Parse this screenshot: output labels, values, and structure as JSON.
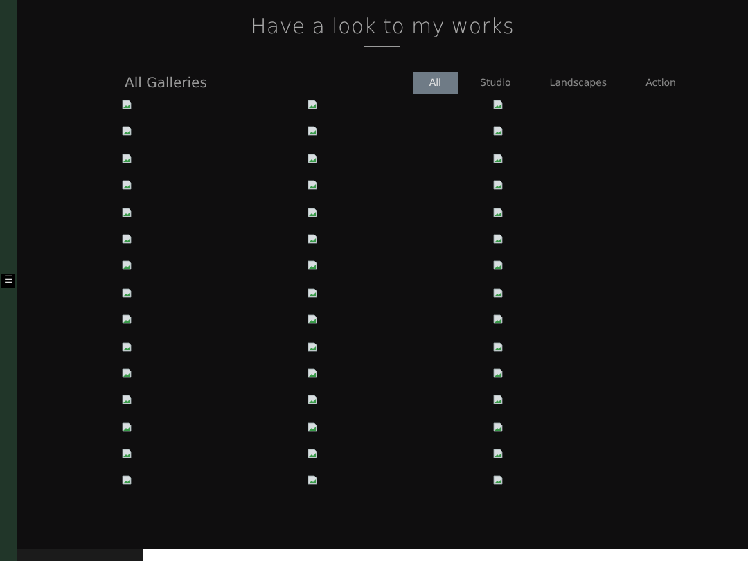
{
  "sidebar": {
    "menu_button": "☰"
  },
  "heading": {
    "title": "Have a look to my works"
  },
  "gallery": {
    "title": "All Galleries",
    "tabs": [
      {
        "label": "All",
        "selected": true
      },
      {
        "label": "Studio",
        "selected": false
      },
      {
        "label": "Landscapes",
        "selected": false
      },
      {
        "label": "Action",
        "selected": false
      }
    ],
    "images": [
      {
        "kind": "broken"
      },
      {
        "kind": "broken"
      },
      {
        "kind": "broken"
      },
      {
        "kind": "broken"
      },
      {
        "kind": "broken"
      },
      {
        "kind": "broken"
      },
      {
        "kind": "broken"
      },
      {
        "kind": "broken"
      },
      {
        "kind": "broken"
      },
      {
        "kind": "broken"
      },
      {
        "kind": "broken"
      },
      {
        "kind": "broken"
      },
      {
        "kind": "broken"
      },
      {
        "kind": "broken"
      },
      {
        "kind": "broken"
      },
      {
        "kind": "broken"
      },
      {
        "kind": "broken"
      },
      {
        "kind": "broken"
      },
      {
        "kind": "broken"
      },
      {
        "kind": "broken"
      },
      {
        "kind": "broken"
      },
      {
        "kind": "broken"
      },
      {
        "kind": "broken"
      },
      {
        "kind": "broken"
      },
      {
        "kind": "broken"
      },
      {
        "kind": "broken"
      },
      {
        "kind": "broken"
      },
      {
        "kind": "broken"
      },
      {
        "kind": "broken"
      },
      {
        "kind": "broken"
      },
      {
        "kind": "broken"
      },
      {
        "kind": "broken"
      },
      {
        "kind": "broken"
      },
      {
        "kind": "broken"
      },
      {
        "kind": "broken"
      },
      {
        "kind": "broken"
      },
      {
        "kind": "broken"
      },
      {
        "kind": "broken"
      },
      {
        "kind": "broken"
      },
      {
        "kind": "broken"
      },
      {
        "kind": "broken"
      },
      {
        "kind": "broken"
      },
      {
        "kind": "broken"
      },
      {
        "kind": "broken"
      },
      {
        "kind": "broken"
      }
    ]
  }
}
